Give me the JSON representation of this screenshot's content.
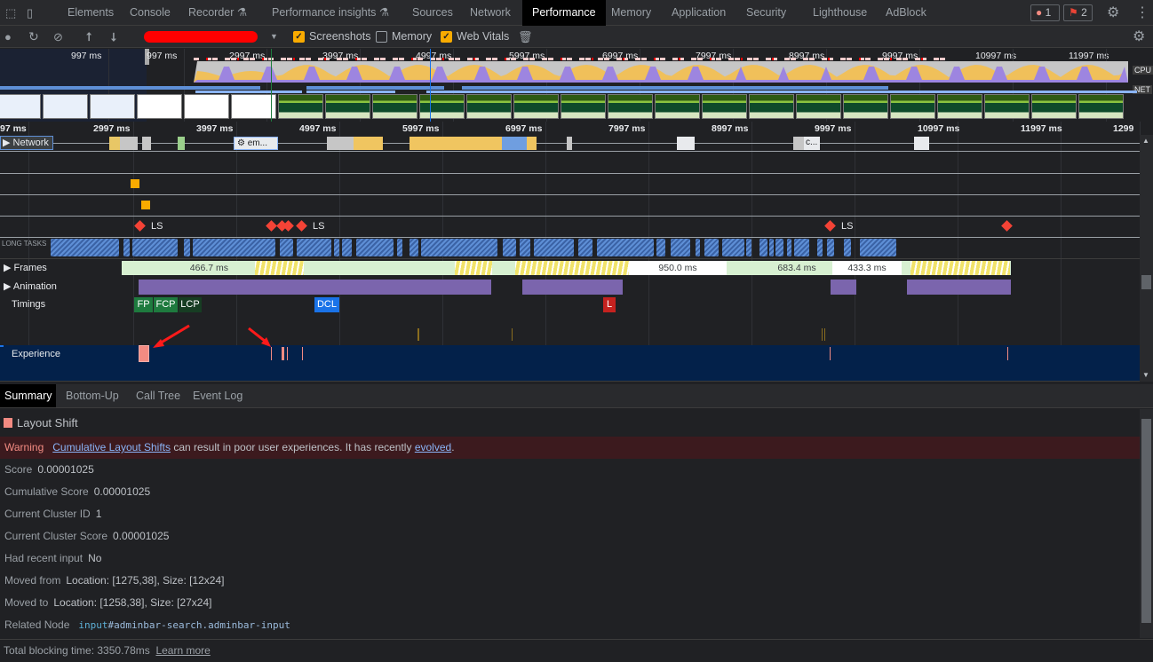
{
  "tabs": [
    {
      "label": "Elements"
    },
    {
      "label": "Console"
    },
    {
      "label": "Recorder"
    },
    {
      "label": "Performance insights"
    },
    {
      "label": "Sources"
    },
    {
      "label": "Network"
    },
    {
      "label": "Performance",
      "active": true
    },
    {
      "label": "Memory"
    },
    {
      "label": "Application"
    },
    {
      "label": "Security"
    },
    {
      "label": "Lighthouse"
    },
    {
      "label": "AdBlock"
    }
  ],
  "badges": {
    "errors": "1",
    "issues": "2"
  },
  "toolbar": {
    "screenshots_label": "Screenshots",
    "screenshots_checked": true,
    "memory_label": "Memory",
    "memory_checked": false,
    "web_vitals_label": "Web Vitals",
    "web_vitals_checked": true
  },
  "overview": {
    "ticks": [
      "997 ms",
      "997 ms",
      "2997 ms",
      "3997 ms",
      "4997 ms",
      "5997 ms",
      "6997 ms",
      "7997 ms",
      "8997 ms",
      "9997 ms",
      "10997 ms",
      "11997 ms"
    ],
    "cpu_label": "CPU",
    "net_label": "NET"
  },
  "ruler": {
    "ticks": [
      "97 ms",
      "2997 ms",
      "3997 ms",
      "4997 ms",
      "5997 ms",
      "6997 ms",
      "7997 ms",
      "8997 ms",
      "9997 ms",
      "10997 ms",
      "11997 ms",
      "1299"
    ]
  },
  "tracks": {
    "network": "Network",
    "network_item": "⚙ em...",
    "network_item2": "c...",
    "ls": "LS",
    "long_tasks": "LONG TASKS",
    "frames": "Frames",
    "animation": "Animation",
    "timings": "Timings",
    "experience": "Experience"
  },
  "frames": [
    "466.7 ms",
    "950.0 ms",
    "683.4 ms",
    "433.3 ms"
  ],
  "timings": {
    "fp": "FP",
    "fcp": "FCP",
    "lcp": "LCP",
    "dcl": "DCL",
    "l": "L"
  },
  "colors": {
    "fp": "#1e7a3e",
    "lcp": "#173d23",
    "dcl": "#1a73e8",
    "l": "#c5221f",
    "layout_shift": "#f28b82",
    "animation": "#7b65ad",
    "long_task": "#5e8fd6"
  },
  "bottom_tabs": [
    "Summary",
    "Bottom-Up",
    "Call Tree",
    "Event Log"
  ],
  "summary": {
    "title": "Layout Shift",
    "warning_label": "Warning",
    "warning_link": "Cumulative Layout Shifts",
    "warning_text": " can result in poor user experiences. It has recently ",
    "warning_link2": "evolved",
    "warning_end": ".",
    "rows": [
      {
        "k": "Score",
        "v": "0.00001025"
      },
      {
        "k": "Cumulative Score",
        "v": "0.00001025"
      },
      {
        "k": "Current Cluster ID",
        "v": "1"
      },
      {
        "k": "Current Cluster Score",
        "v": "0.00001025"
      },
      {
        "k": "Had recent input",
        "v": "No"
      },
      {
        "k": "Moved from",
        "v": "Location: [1275,38], Size: [12x24]"
      },
      {
        "k": "Moved to",
        "v": "Location: [1258,38], Size: [27x24]"
      }
    ],
    "related_node_label": "Related Node",
    "node_tag": "input",
    "node_rest": "#adminbar-search.adminbar-input"
  },
  "footer": {
    "text": "Total blocking time: 3350.78ms",
    "link": "Learn more"
  }
}
